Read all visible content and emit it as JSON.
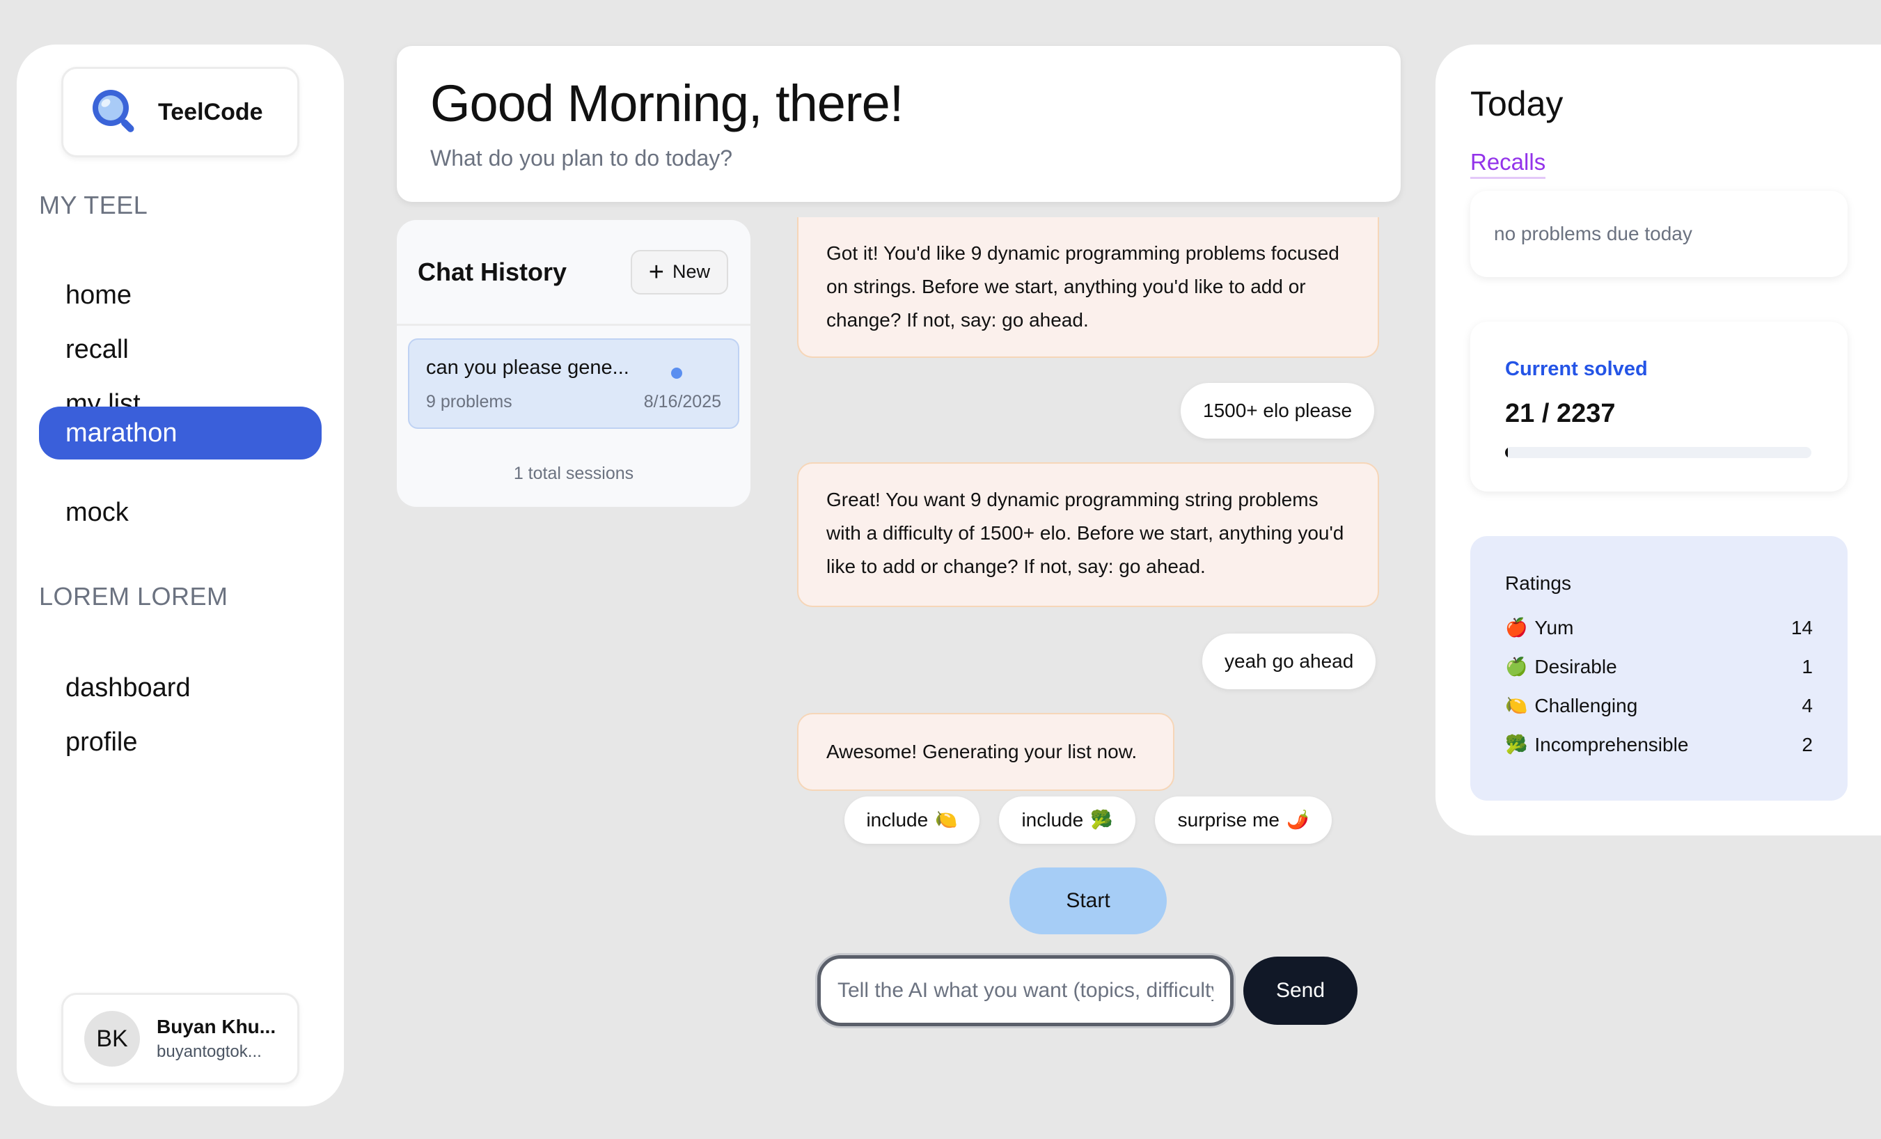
{
  "brand": {
    "name": "TeelCode",
    "icon": "magnifier-logo"
  },
  "sidebar": {
    "section1_title": "MY TEEL",
    "section1_items": [
      {
        "label": "home"
      },
      {
        "label": "recall"
      },
      {
        "label": "my list"
      },
      {
        "label": "marathon",
        "active": true
      },
      {
        "label": "mock"
      }
    ],
    "section2_title": "LOREM LOREM",
    "section2_items": [
      {
        "label": "dashboard"
      },
      {
        "label": "profile"
      }
    ],
    "accent": "#3a5fda"
  },
  "user": {
    "initials": "BK",
    "name": "Buyan Khu...",
    "email": "buyantogtok..."
  },
  "greeting": {
    "title": "Good Morning, there!",
    "subtitle": "What do you plan to do today?"
  },
  "history": {
    "title": "Chat History",
    "new_label": "New",
    "sessions": [
      {
        "title": "can you please gene...",
        "count": "9 problems",
        "date": "8/16/2025"
      }
    ],
    "total": "1 total sessions"
  },
  "chat": {
    "messages": [
      {
        "role": "assistant",
        "text": "Got it! You'd like 9 dynamic programming problems focused on strings. Before we start, anything you'd like to add or change? If not, say: go ahead."
      },
      {
        "role": "user",
        "text": "1500+ elo please"
      },
      {
        "role": "assistant",
        "text": "Great! You want 9 dynamic programming string problems with a difficulty of 1500+ elo. Before we start, anything you'd like to add or change? If not, say: go ahead."
      },
      {
        "role": "user",
        "text": "yeah go ahead"
      },
      {
        "role": "assistant",
        "text": "Awesome! Generating your list now."
      }
    ],
    "chips": [
      {
        "label": "include",
        "emoji": "🍋"
      },
      {
        "label": "include",
        "emoji": "🥦"
      },
      {
        "label": "surprise me",
        "emoji": "🌶️"
      }
    ],
    "start_label": "Start",
    "input_placeholder": "Tell the AI what you want (topics, difficulty",
    "send_label": "Send"
  },
  "today": {
    "title": "Today",
    "recalls_label": "Recalls",
    "recalls_empty": "no problems due today",
    "solved_label": "Current solved",
    "solved_value": "21 / 2237",
    "solved_progress": 0.0094,
    "ratings_title": "Ratings",
    "ratings": [
      {
        "emoji": "🍎",
        "label": "Yum",
        "count": "14"
      },
      {
        "emoji": "🍏",
        "label": "Desirable",
        "count": "1"
      },
      {
        "emoji": "🍋",
        "label": "Challenging",
        "count": "4"
      },
      {
        "emoji": "🥦",
        "label": "Incomprehensible",
        "count": "2"
      }
    ]
  }
}
